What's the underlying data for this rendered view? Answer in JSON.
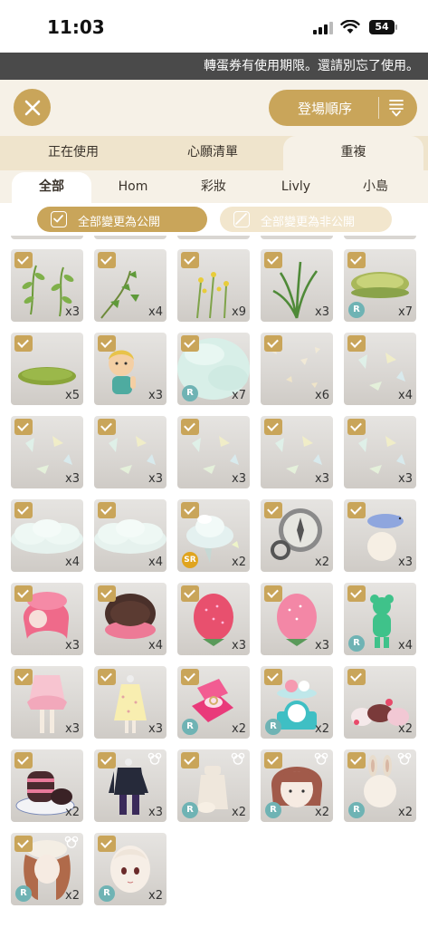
{
  "status": {
    "time": "11:03",
    "battery": "54"
  },
  "ticker": "轉蛋券有使用期限。還請別忘了使用。",
  "sort_label": "登場順序",
  "tabs_primary": [
    "正在使用",
    "心願清單",
    "重複"
  ],
  "tabs_secondary": [
    "全部",
    "Hom",
    "彩妝",
    "Livly",
    "小島"
  ],
  "actions": {
    "public": "全部變更為公開",
    "private": "全部變更為非公開"
  },
  "items": [
    {
      "count": "x3",
      "badge": "",
      "art": "sprig"
    },
    {
      "count": "x4",
      "badge": "",
      "art": "vine"
    },
    {
      "count": "x9",
      "badge": "",
      "art": "yellowflower"
    },
    {
      "count": "x3",
      "badge": "",
      "art": "grass"
    },
    {
      "count": "x7",
      "badge": "R",
      "art": "pond"
    },
    {
      "count": "x5",
      "badge": "",
      "art": "mat"
    },
    {
      "count": "x3",
      "badge": "",
      "art": "boy"
    },
    {
      "count": "x7",
      "badge": "R",
      "art": "mist"
    },
    {
      "count": "x6",
      "badge": "",
      "art": "petals"
    },
    {
      "count": "x4",
      "badge": "",
      "art": "shards"
    },
    {
      "count": "x3",
      "badge": "",
      "art": "shards"
    },
    {
      "count": "x3",
      "badge": "",
      "art": "shards"
    },
    {
      "count": "x3",
      "badge": "",
      "art": "shards"
    },
    {
      "count": "x3",
      "badge": "",
      "art": "shards"
    },
    {
      "count": "x3",
      "badge": "",
      "art": "shards"
    },
    {
      "count": "x4",
      "badge": "",
      "art": "cloud"
    },
    {
      "count": "x4",
      "badge": "",
      "art": "cloud"
    },
    {
      "count": "x2",
      "badge": "SR",
      "art": "cloudtree"
    },
    {
      "count": "x2",
      "badge": "",
      "art": "compass"
    },
    {
      "count": "x3",
      "badge": "",
      "art": "lizardhead"
    },
    {
      "count": "x3",
      "badge": "",
      "art": "pinkhair"
    },
    {
      "count": "x4",
      "badge": "",
      "art": "cookiehat"
    },
    {
      "count": "x3",
      "badge": "",
      "art": "strawberry"
    },
    {
      "count": "x3",
      "badge": "",
      "art": "strawberrylight"
    },
    {
      "count": "x4",
      "badge": "R",
      "art": "greenbear"
    },
    {
      "count": "x3",
      "badge": "",
      "art": "pinkdress"
    },
    {
      "count": "x3",
      "badge": "",
      "art": "yellowdress"
    },
    {
      "count": "x2",
      "badge": "R",
      "art": "ringbox"
    },
    {
      "count": "x2",
      "badge": "R",
      "art": "scale"
    },
    {
      "count": "x2",
      "badge": "",
      "art": "sweets"
    },
    {
      "count": "x2",
      "badge": "",
      "art": "macarons"
    },
    {
      "count": "x3",
      "badge": "",
      "art": "darkoutfit"
    },
    {
      "count": "x2",
      "badge": "R",
      "art": "bottle"
    },
    {
      "count": "x2",
      "badge": "R",
      "art": "bobhair"
    },
    {
      "count": "x2",
      "badge": "R",
      "art": "bunnyhead"
    },
    {
      "count": "x2",
      "badge": "R",
      "art": "longhair"
    },
    {
      "count": "x2",
      "badge": "R",
      "art": "face"
    }
  ],
  "bear_items": [
    32,
    33,
    34,
    35,
    36
  ]
}
